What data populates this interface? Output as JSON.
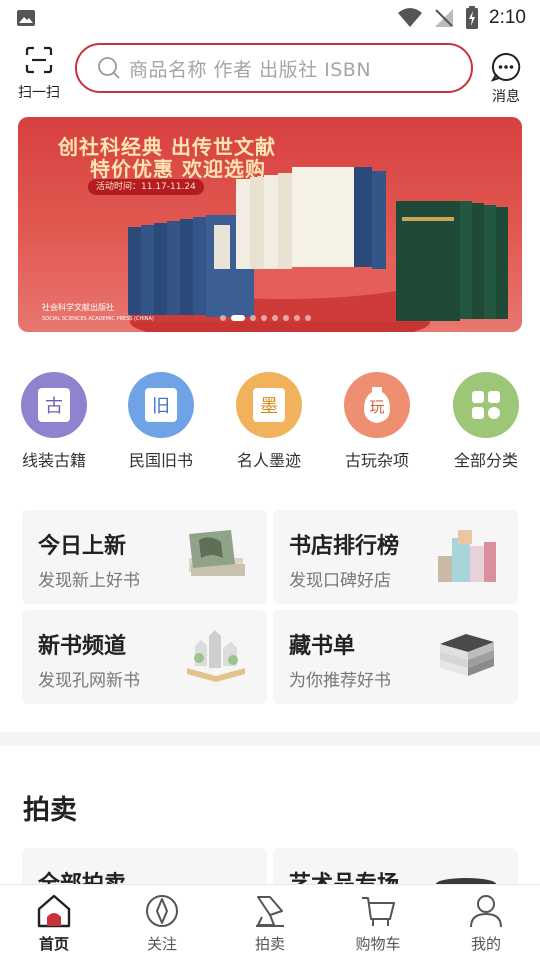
{
  "status_bar": {
    "time": "2:10"
  },
  "header": {
    "scan_label": "扫一扫",
    "search_placeholder": "商品名称 作者 出版社 ISBN",
    "message_label": "消息"
  },
  "banner": {
    "headline_1": "创社科经典 出传世文献",
    "headline_2": "特价优惠 欢迎选购",
    "date_text": "活动时间：11.17-11.24",
    "publisher_cn": "社会科学文献出版社",
    "publisher_en": "SOCIAL SCIENCES ACADEMIC PRESS (CHINA)",
    "slide_count": 8,
    "active_slide": 1
  },
  "categories": [
    {
      "label": "线装古籍",
      "glyph": "古",
      "icon": "thread-bound-book-icon",
      "color": "#8f82cf"
    },
    {
      "label": "民国旧书",
      "glyph": "旧",
      "icon": "old-book-icon",
      "color": "#6fa3e6"
    },
    {
      "label": "名人墨迹",
      "glyph": "墨",
      "icon": "calligraphy-icon",
      "color": "#f1b25c"
    },
    {
      "label": "古玩杂项",
      "glyph": "玩",
      "icon": "antique-vase-icon",
      "color": "#ef8f72"
    },
    {
      "label": "全部分类",
      "glyph": "",
      "icon": "grid-icon",
      "color": "#9dc677"
    }
  ],
  "features": [
    {
      "title": "今日上新",
      "subtitle": "发现新上好书"
    },
    {
      "title": "书店排行榜",
      "subtitle": "发现口碑好店"
    },
    {
      "title": "新书频道",
      "subtitle": "发现孔网新书"
    },
    {
      "title": "藏书单",
      "subtitle": "为你推荐好书"
    }
  ],
  "auction": {
    "section_title": "拍卖",
    "cards": [
      {
        "title": "全部拍卖"
      },
      {
        "title": "艺术品专场"
      }
    ]
  },
  "bottom_nav": [
    {
      "label": "首页",
      "icon": "home-icon",
      "active": true
    },
    {
      "label": "关注",
      "icon": "compass-icon",
      "active": false
    },
    {
      "label": "拍卖",
      "icon": "auction-hammer-icon",
      "active": false
    },
    {
      "label": "购物车",
      "icon": "cart-icon",
      "active": false
    },
    {
      "label": "我的",
      "icon": "user-icon",
      "active": false
    }
  ],
  "colors": {
    "accent": "#c8323c",
    "banner_red": "#d7403f"
  }
}
